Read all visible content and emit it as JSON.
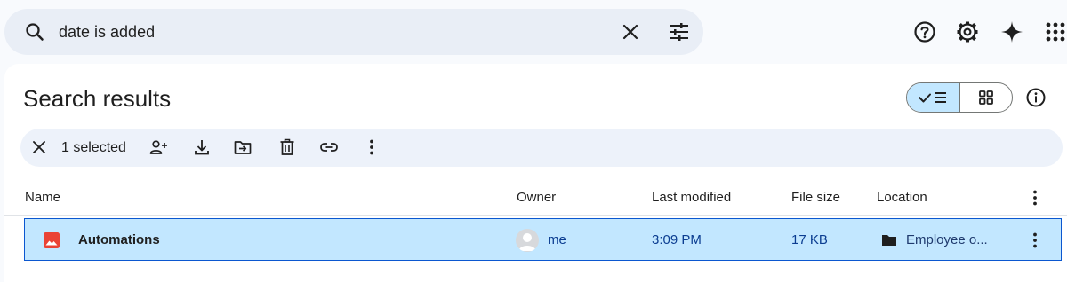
{
  "search": {
    "query": "date is added",
    "search_icon": "search-icon",
    "clear_icon": "close-icon",
    "filter_icon": "tune-icon"
  },
  "top_actions": [
    {
      "name": "help",
      "icon": "help-circle-icon"
    },
    {
      "name": "settings",
      "icon": "gear-icon"
    },
    {
      "name": "gemini",
      "icon": "sparkle-icon"
    },
    {
      "name": "apps",
      "icon": "apps-grid-icon"
    }
  ],
  "page": {
    "title": "Search results"
  },
  "view_toggle": {
    "active": "list",
    "options": [
      "list",
      "grid"
    ]
  },
  "selection_bar": {
    "selected_text": "1 selected",
    "actions": [
      "share",
      "download",
      "move",
      "delete",
      "copy-link",
      "more"
    ]
  },
  "table": {
    "columns": [
      "Name",
      "Owner",
      "Last modified",
      "File size",
      "Location"
    ],
    "rows": [
      {
        "name": "Automations",
        "type_icon": "image-file-icon",
        "owner": "me",
        "last_modified": "3:09 PM",
        "file_size": "17 KB",
        "location": "Employee o...",
        "location_icon": "folder-icon",
        "selected": true
      }
    ]
  },
  "colors": {
    "accent": "#0b57d0",
    "selected_row": "#c2e7ff",
    "image_icon_red": "#ea4335"
  }
}
